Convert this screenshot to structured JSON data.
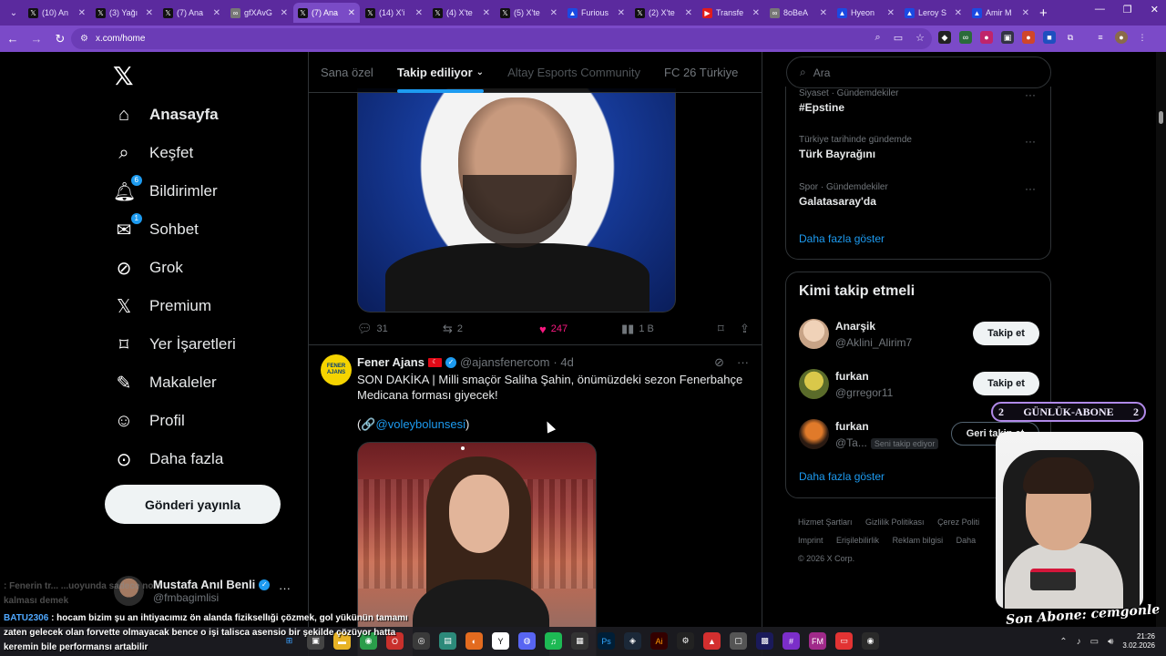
{
  "browser": {
    "tabs": [
      {
        "label": "(10) An",
        "icon": "x-icon",
        "active": false
      },
      {
        "label": "(3) Yağı",
        "icon": "x-icon",
        "active": false
      },
      {
        "label": "(7) Ana",
        "icon": "x-icon",
        "active": false
      },
      {
        "label": "gfXAvG",
        "icon": "link-icon",
        "active": false
      },
      {
        "label": "(7) Ana",
        "icon": "x-icon",
        "active": true
      },
      {
        "label": "(14) X'i",
        "icon": "x-icon",
        "active": false
      },
      {
        "label": "(4) X'te",
        "icon": "x-icon",
        "active": false
      },
      {
        "label": "(5) X'te",
        "icon": "x-icon",
        "active": false
      },
      {
        "label": "Furious",
        "icon": "generic-icon",
        "active": false
      },
      {
        "label": "(2) X'te",
        "icon": "x-icon",
        "active": false
      },
      {
        "label": "Transfe",
        "icon": "youtube-icon",
        "active": false
      },
      {
        "label": "8oBeA",
        "icon": "link-icon",
        "active": false
      },
      {
        "label": "Hyeon",
        "icon": "generic-icon",
        "active": false
      },
      {
        "label": "Leroy S",
        "icon": "generic-icon",
        "active": false
      },
      {
        "label": "Amir M",
        "icon": "generic-icon",
        "active": false
      }
    ],
    "url": "x.com/home"
  },
  "nav": {
    "items": [
      {
        "label": "Anasayfa",
        "icon": "home-icon",
        "active": true
      },
      {
        "label": "Keşfet",
        "icon": "search-icon",
        "active": false
      },
      {
        "label": "Bildirimler",
        "icon": "bell-icon",
        "badge": "6",
        "active": false
      },
      {
        "label": "Sohbet",
        "icon": "mail-icon",
        "badge": "1",
        "active": false
      },
      {
        "label": "Grok",
        "icon": "grok-icon",
        "active": false
      },
      {
        "label": "Premium",
        "icon": "x-icon",
        "active": false
      },
      {
        "label": "Yer İşaretleri",
        "icon": "bookmark-icon",
        "active": false
      },
      {
        "label": "Makaleler",
        "icon": "article-icon",
        "active": false
      },
      {
        "label": "Profil",
        "icon": "person-icon",
        "active": false
      },
      {
        "label": "Daha fazla",
        "icon": "more-circle-icon",
        "active": false
      }
    ],
    "post_button": "Gönderi yayınla",
    "account": {
      "name": "Mustafa Anıl Benli",
      "handle": "@fmbagimlisi"
    }
  },
  "timeline": {
    "tabs": [
      "Sana özel",
      "Takip ediliyor",
      "Altay Esports Community",
      "FC 26 Türkiye"
    ],
    "active_tab": "Takip ediliyor",
    "post1": {
      "replies": "31",
      "reposts": "2",
      "likes": "247",
      "views": "1 B"
    },
    "post2": {
      "name": "Fener Ajans",
      "avatar_text": "FENER AJANS",
      "handle": "@ajansfenercom",
      "time": "· 4d",
      "text": "SON DAKİKA | Milli smaçör Saliha Şahin, önümüzdeki sezon Fenerbahçe Medicana forması giyecek!",
      "link_prefix": "(🔗",
      "mention": "@voleybolunsesi",
      "link_suffix": ")"
    }
  },
  "sidebar": {
    "search_placeholder": "Ara",
    "trends": [
      {
        "meta": "Siyaset · Gündemdekiler",
        "name": "#Epstine"
      },
      {
        "meta": "Türkiye tarihinde gündemde",
        "name": "Türk Bayrağını"
      },
      {
        "meta": "Spor · Gündemdekiler",
        "name": "Galatasaray'da"
      }
    ],
    "trends_more": "Daha fazla göster",
    "who_to_follow": {
      "title": "Kimi takip etmeli",
      "accounts": [
        {
          "name": "Anarşik",
          "handle": "@Aklini_Alirim7",
          "button": "Takip et"
        },
        {
          "name": "furkan",
          "handle": "@grregor11",
          "button": "Takip et"
        },
        {
          "name": "furkan",
          "handle": "@Ta...",
          "tag": "Seni takip ediyor",
          "button": "Geri takip et"
        }
      ],
      "more": "Daha fazla göster"
    },
    "footer": [
      "Hizmet Şartları",
      "Gizlilik Politikası",
      "Çerez Politi",
      "Imprint",
      "Erişilebilirlik",
      "Reklam bilgisi",
      "Daha",
      "© 2026 X Corp."
    ]
  },
  "overlay": {
    "sub_banner": {
      "left": "2",
      "label": "GÜNLÜK-ABONE",
      "right": "2"
    },
    "last_sub": "Son Abone: cemgonle",
    "chat": {
      "faded1_user": "",
      "faded1_text": ": Fenerin tr...       ...uoyunda sadece no",
      "faded2_text": "kalması demek",
      "user": "BATU2306",
      "message": ": hocam bizim şu an ihtiyacımız ön alanda fiziksellıği çözmek, gol yükünün tamamı zaten gelecek olan forvette olmayacak bence o işi talisca asensio bir şekilde çözüyor hatta keremin bile performansı artabilir"
    }
  },
  "taskbar": {
    "time": "21:26",
    "date": "3.02.2026"
  }
}
